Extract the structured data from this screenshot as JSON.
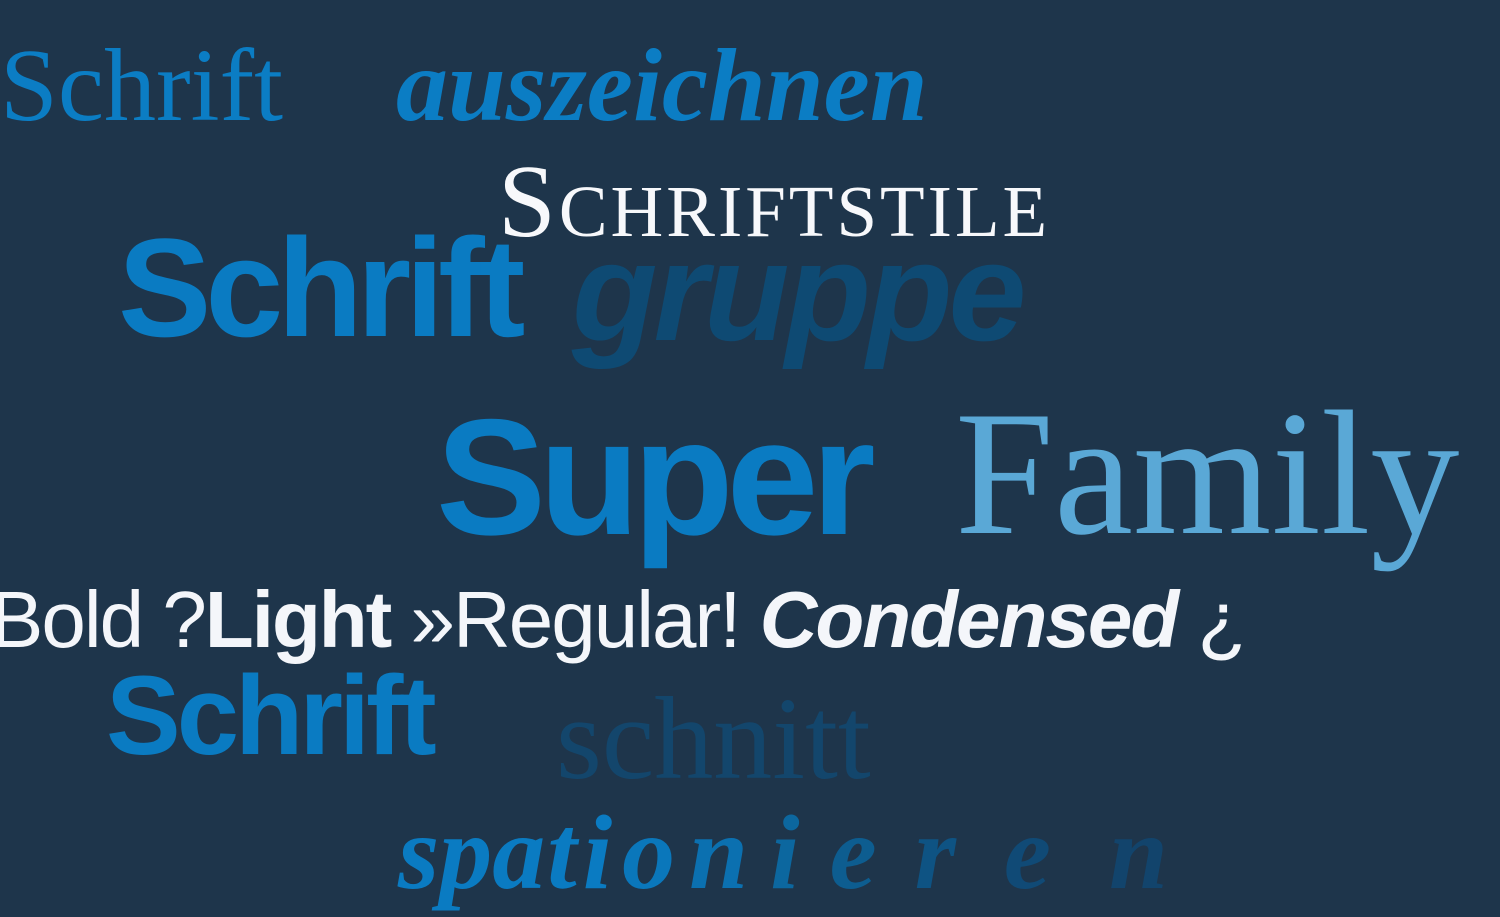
{
  "lines": {
    "line1": {
      "part1": "Schrift",
      "part2": "auszeichnen"
    },
    "line2": {
      "text": "Schriftstile"
    },
    "line3": {
      "part1": "Schrift",
      "part2": "gruppe"
    },
    "line4": {
      "part1": "Super",
      "part2": "Family"
    },
    "line5": {
      "bold": "Bold ?",
      "light": "Light",
      "regular": " »Regular! ",
      "condensed": "Condensed",
      "mark": " ¿"
    },
    "line6": {
      "part1": "Schrift",
      "part2": "schnitt"
    },
    "line7": {
      "letters": [
        "s",
        "p",
        "a",
        "t",
        "i",
        "o",
        "n",
        "i",
        "e",
        "r",
        "e",
        "n"
      ]
    }
  },
  "colors": {
    "background": "#1e354b",
    "blue": "#0a7bc2",
    "dark_blue": "#13466c",
    "light_blue": "#5aa8d6",
    "white": "#f4f6fa"
  }
}
